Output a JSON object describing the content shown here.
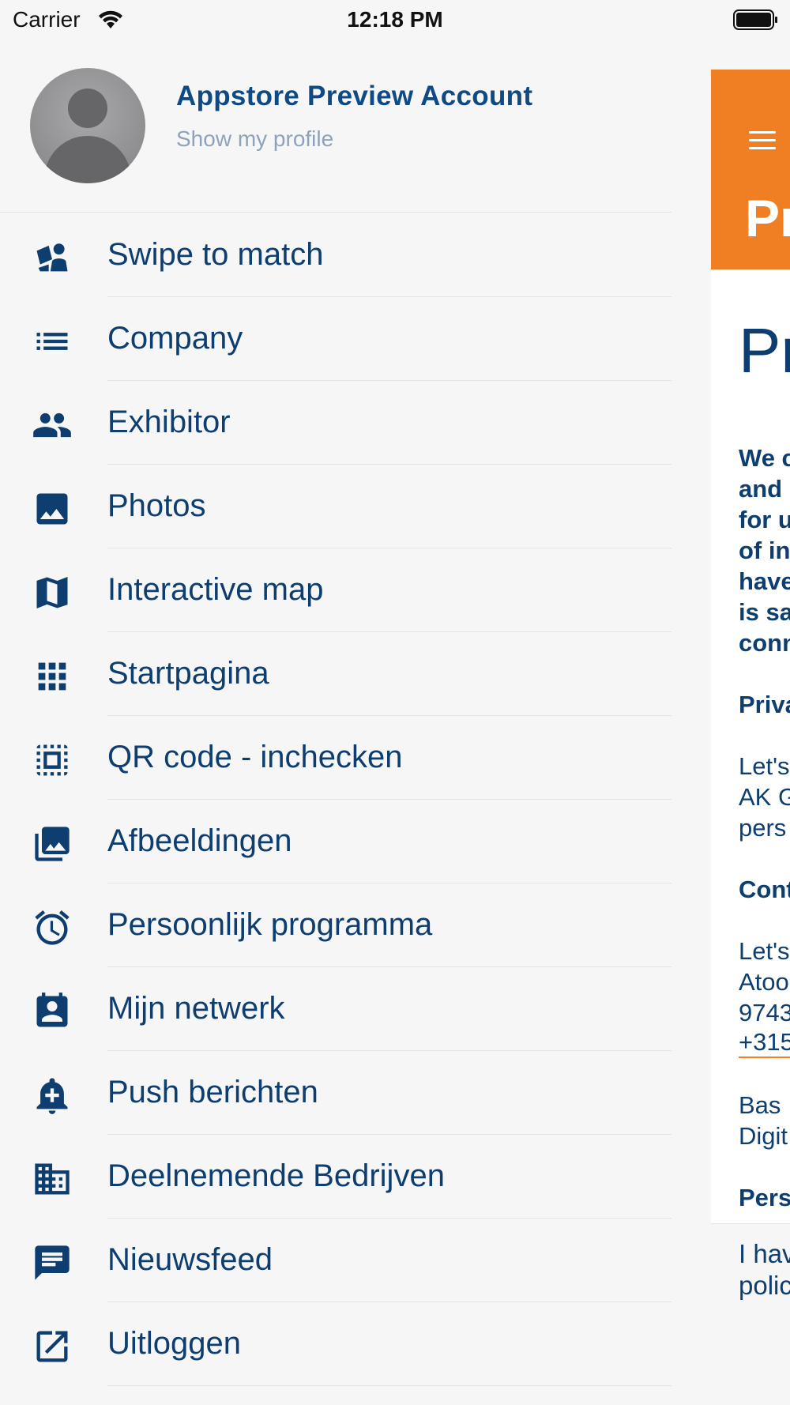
{
  "status_bar": {
    "carrier": "Carrier",
    "time": "12:18 PM"
  },
  "profile": {
    "name": "Appstore Preview Account",
    "subtitle": "Show my profile"
  },
  "menu": [
    {
      "label": "Swipe to match",
      "icon": "swipe-match-icon"
    },
    {
      "label": "Company",
      "icon": "list-icon"
    },
    {
      "label": "Exhibitor",
      "icon": "people-icon"
    },
    {
      "label": "Photos",
      "icon": "image-icon"
    },
    {
      "label": "Interactive map",
      "icon": "map-icon"
    },
    {
      "label": "Startpagina",
      "icon": "grid-icon"
    },
    {
      "label": "QR code - inchecken",
      "icon": "qr-scan-icon"
    },
    {
      "label": "Afbeeldingen",
      "icon": "photo-library-icon"
    },
    {
      "label": "Persoonlijk programma",
      "icon": "alarm-icon"
    },
    {
      "label": "Mijn netwerk",
      "icon": "contact-card-icon"
    },
    {
      "label": "Push berichten",
      "icon": "bell-add-icon"
    },
    {
      "label": "Deelnemende Bedrijven",
      "icon": "building-icon"
    },
    {
      "label": "Nieuwsfeed",
      "icon": "message-icon"
    },
    {
      "label": "Uitloggen",
      "icon": "open-external-icon"
    }
  ],
  "background_page": {
    "header_title": "Pr",
    "heading": "Pr",
    "bold_lines": [
      "We c",
      "and",
      "for u",
      "of in",
      "have",
      "is sa",
      "conn"
    ],
    "section_1": "Priva",
    "text_1": [
      "Let's",
      "AK G",
      "pers"
    ],
    "section_2": "Cont",
    "text_2": [
      "Let's",
      "Atoo",
      "9743"
    ],
    "phone": "+315",
    "text_3": [
      "Bas",
      "Digit"
    ],
    "section_3": "Pers",
    "footer_text": [
      "I hav",
      "polic"
    ]
  },
  "colors": {
    "accent": "#f07f23",
    "primary": "#0e3e6f",
    "background": "#f6f6f6"
  }
}
